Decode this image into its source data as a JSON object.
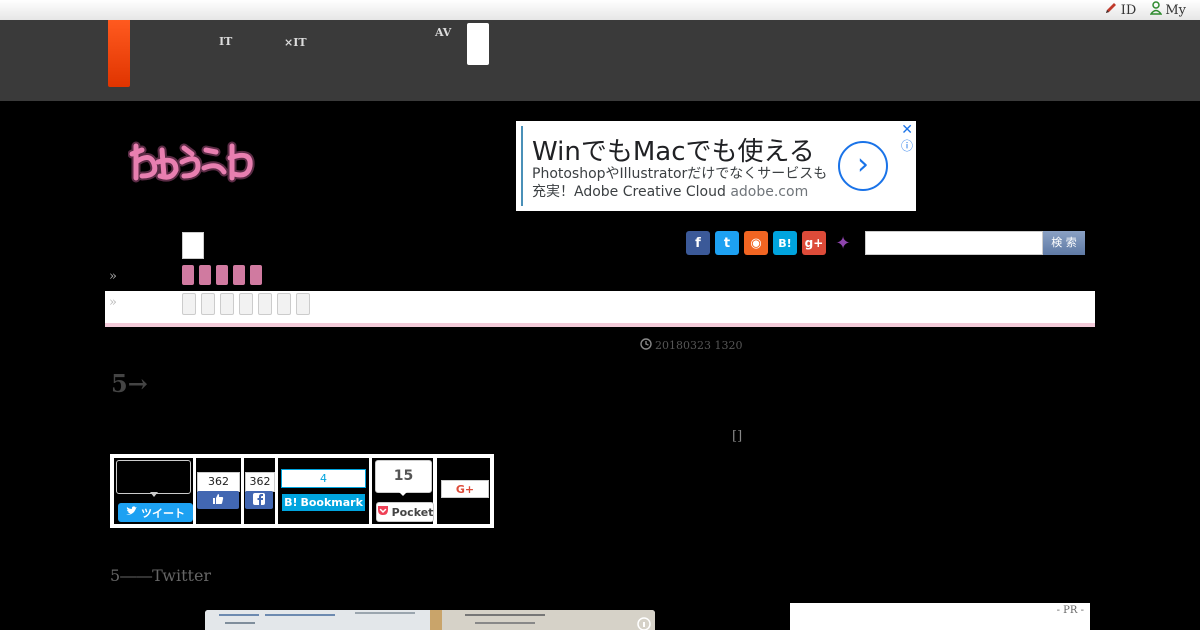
{
  "header": {
    "user_links": [
      {
        "label": "ID",
        "icon": "pencil-icon"
      },
      {
        "label": "My",
        "icon": "user-icon"
      }
    ]
  },
  "global_nav": {
    "items": [
      {
        "line1": "",
        "line2": "IT"
      },
      {
        "line1": "",
        "line2": "×IT"
      },
      {
        "line1": "AV",
        "line2": ""
      }
    ]
  },
  "ad": {
    "headline": "WinでもMacでも使える",
    "body": "PhotoshopやIllustratorだけでなくサービスも充実！Adobe Creative Cloud",
    "domain": "adobe.com",
    "close": "✕",
    "info": "ⓘ",
    "cta": "›"
  },
  "social": {
    "icons": [
      {
        "name": "facebook-icon",
        "glyph": "f",
        "color": "#3b5998"
      },
      {
        "name": "twitter-icon",
        "glyph": "t",
        "color": "#1da1f2"
      },
      {
        "name": "rss-icon",
        "glyph": "◉",
        "color": "#f26522"
      },
      {
        "name": "hatena-icon",
        "glyph": "B!",
        "color": "#00a4de"
      },
      {
        "name": "googleplus-icon",
        "glyph": "g+",
        "color": "#dd4b39"
      },
      {
        "name": "cat-icon",
        "glyph": "✦",
        "color": "#8e44ad"
      }
    ]
  },
  "search": {
    "button_label": "検 索",
    "placeholder": ""
  },
  "breadcrumbs": {
    "marker1": "»",
    "marker2": "»"
  },
  "article": {
    "date": "20180323 1320",
    "title": "5→",
    "bracket": "[]",
    "lead": "5――Twitter"
  },
  "share": {
    "tweet_label": "ツイート",
    "fb_like_count": "362",
    "fb_share_count": "362",
    "hatena_count": "4",
    "hatena_label": "Bookmark",
    "pocket_count": "15",
    "pocket_label": "Pocket",
    "gplus_label": "G+"
  },
  "sidebar": {
    "pr_label": "- PR -"
  }
}
